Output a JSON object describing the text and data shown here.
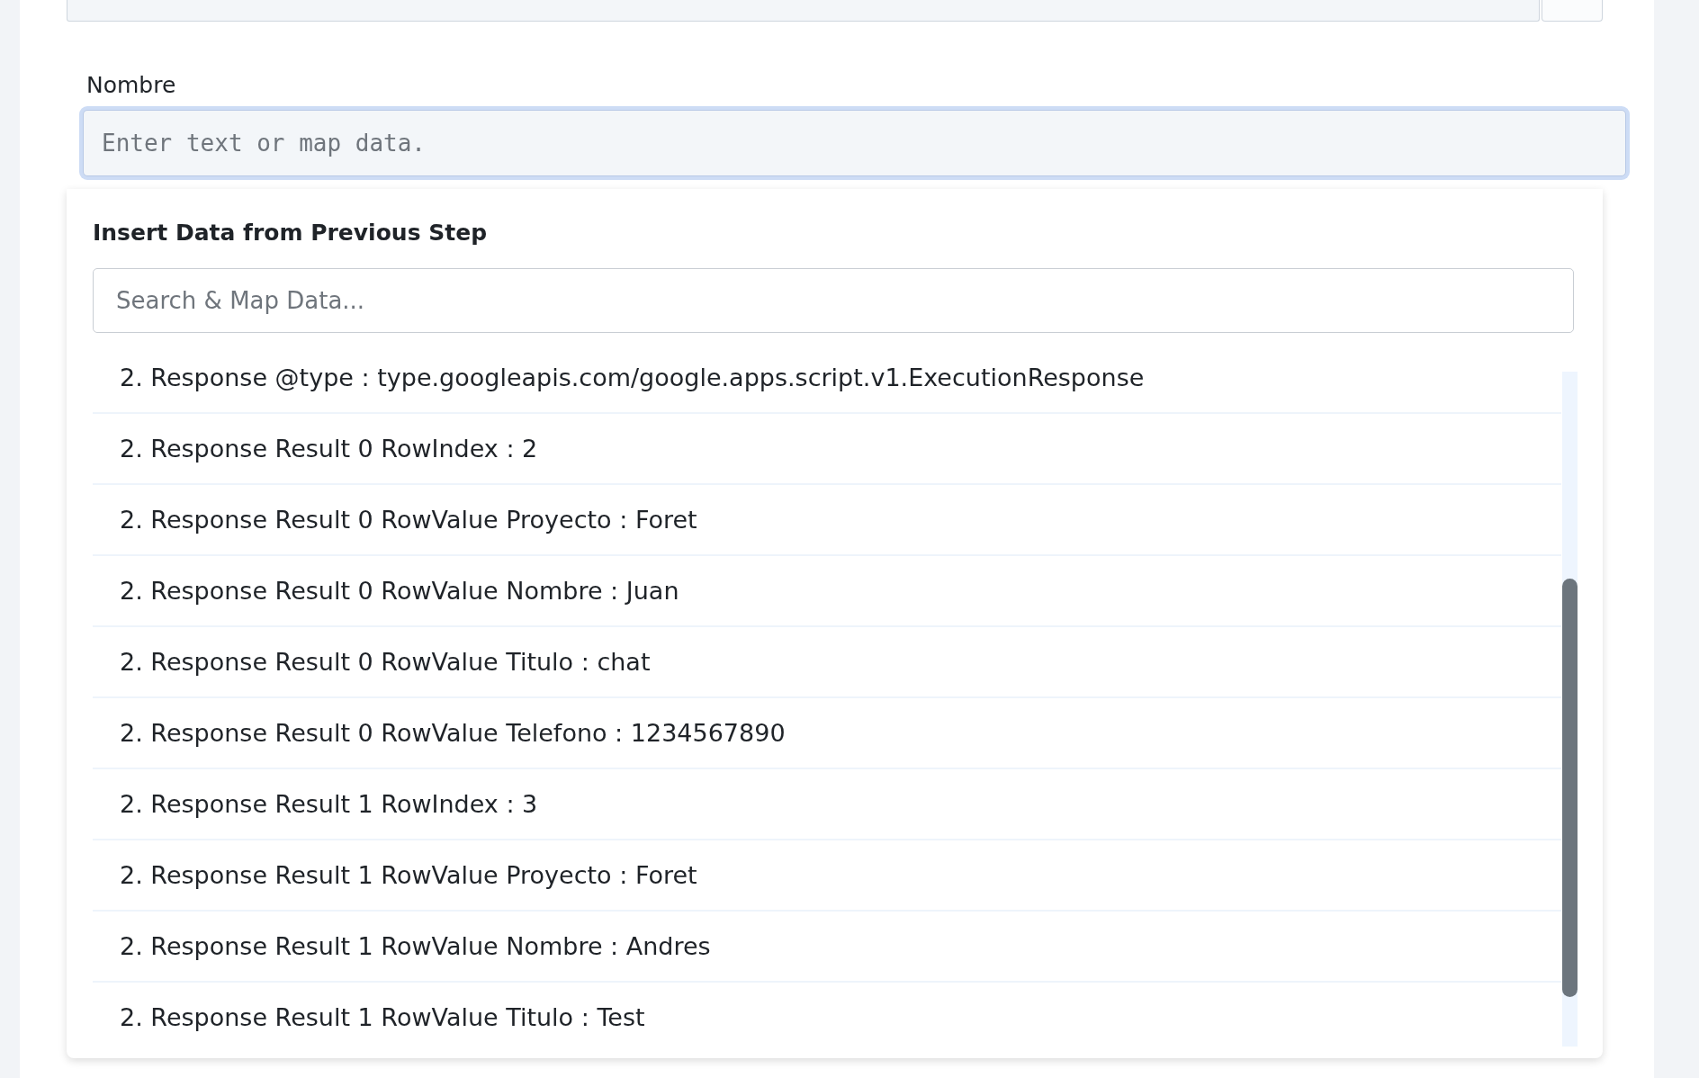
{
  "field": {
    "label": "Nombre",
    "placeholder": "Enter text or map data."
  },
  "dropdown": {
    "title": "Insert Data from Previous Step",
    "search": {
      "placeholder": "Search & Map Data..."
    },
    "items": [
      "2. Response @type : type.googleapis.com/google.apps.script.v1.ExecutionResponse",
      "2. Response Result 0 RowIndex : 2",
      "2. Response Result 0 RowValue Proyecto : Foret",
      "2. Response Result 0 RowValue Nombre : Juan",
      "2. Response Result 0 RowValue Titulo : chat",
      "2. Response Result 0 RowValue Telefono : 1234567890",
      "2. Response Result 1 RowIndex : 3",
      "2. Response Result 1 RowValue Proyecto : Foret",
      "2. Response Result 1 RowValue Nombre : Andres",
      "2. Response Result 1 RowValue Titulo : Test"
    ]
  }
}
